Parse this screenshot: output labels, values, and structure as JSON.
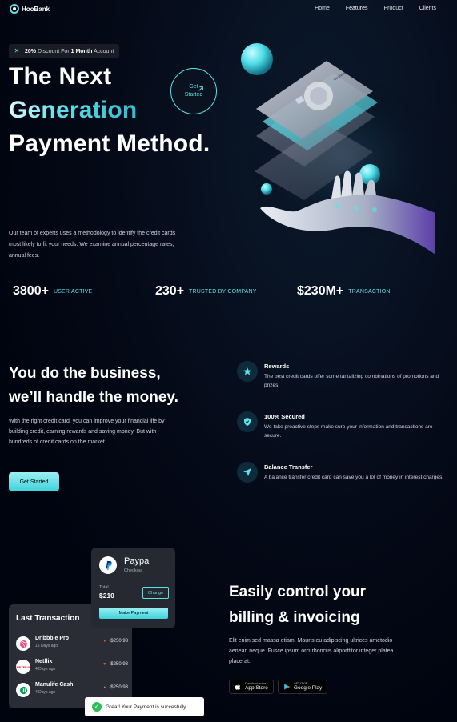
{
  "nav": {
    "brand": "HooBank",
    "links": [
      "Home",
      "Features",
      "Product",
      "Clients"
    ],
    "active_link": "Features"
  },
  "hero": {
    "badge_strong_pct": "20%",
    "badge_text_1": "Discount For",
    "badge_strong_month": "1 Month",
    "badge_text_2": "Account",
    "title_line1": "The Next",
    "title_line2": "Generation",
    "title_line3": "Payment Method.",
    "cta_line1": "Get",
    "cta_line2": "Started",
    "description": "Our team of experts uses a methodology to identify the credit cards most likely to fit your needs. We examine annual percentage rates, annual fees."
  },
  "stats": [
    {
      "value": "3800+",
      "label": "USER ACTIVE"
    },
    {
      "value": "230+",
      "label": "TRUSTED BY COMPANY"
    },
    {
      "value": "$230M+",
      "label": "TRANSACTION"
    }
  ],
  "business": {
    "title_line1": "You do the business,",
    "title_line2": "we’ll handle the money.",
    "description": "With the right credit card, you can improve your financial life by building credit, earning rewards and saving money. But with hundreds of credit cards on the market.",
    "button": "Get Started",
    "features": [
      {
        "icon": "star-icon",
        "title": "Rewards",
        "text": "The best credit cards offer some tantalizing combinations of promotions and prizes"
      },
      {
        "icon": "shield-icon",
        "title": "100% Secured",
        "text": "We take proactive steps make sure your information and transactions are secure."
      },
      {
        "icon": "send-icon",
        "title": "Balance Transfer",
        "text": "A balance transfer credit card can save you a lot of money in interest charges."
      }
    ]
  },
  "paypal": {
    "name": "Paypal",
    "sub": "Checkout",
    "total_label": "Total",
    "total": "$210",
    "change": "Change",
    "make_payment": "Make Payment"
  },
  "transactions": {
    "title": "Last Transaction",
    "rows": [
      {
        "name": "Dribbble Pro",
        "date": "15 Days ago",
        "amount": "-$250,93",
        "direction": "down",
        "icon": "dribbble-icon"
      },
      {
        "name": "Netflix",
        "date": "4 Days ago",
        "amount": "-$250,93",
        "direction": "down",
        "icon": "netflix-icon"
      },
      {
        "name": "Manulife Cash",
        "date": "4 Days ago",
        "amount": "-$250,93",
        "direction": "up",
        "icon": "manulife-icon"
      }
    ]
  },
  "toast": "Great! Your Payment is succesfully.",
  "billing": {
    "title_line1": "Easily control your",
    "title_line2": "billing & invoicing",
    "description": "Elit enim sed massa etiam. Mauris eu adipiscing ultrices ametodio aenean neque. Fusce ipsum orci rhoncus aliporttitor integer platea placerat.",
    "app_store_small": "Download on the",
    "app_store_big": "App Store",
    "google_play_small": "GET IT ON",
    "google_play_big": "Google Play"
  },
  "colors": {
    "background": "#00040f",
    "accent": "#5ce1e6",
    "card": "#2b2d36"
  }
}
